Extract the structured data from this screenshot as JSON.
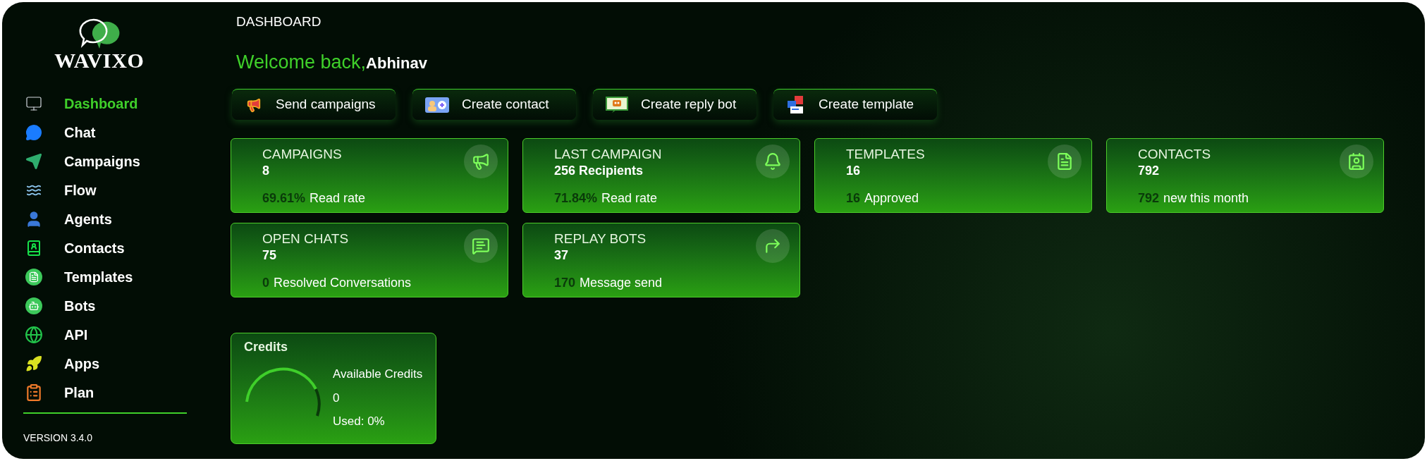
{
  "logo": {
    "text": "WAVIXO"
  },
  "sidebar": {
    "items": [
      {
        "label": "Dashboard",
        "selected": true
      },
      {
        "label": "Chat",
        "selected": false
      },
      {
        "label": "Campaigns",
        "selected": false
      },
      {
        "label": "Flow",
        "selected": false
      },
      {
        "label": "Agents",
        "selected": false
      },
      {
        "label": "Contacts",
        "selected": false
      },
      {
        "label": "Templates",
        "selected": false
      },
      {
        "label": "Bots",
        "selected": false
      },
      {
        "label": "API",
        "selected": false
      },
      {
        "label": "Apps",
        "selected": false
      },
      {
        "label": "Plan",
        "selected": false
      }
    ],
    "version": "VERSION 3.4.0"
  },
  "page_title": "DASHBOARD",
  "welcome": {
    "greeting": "Welcome back,",
    "name": "Abhinav"
  },
  "quick_actions": [
    "Send campaigns",
    "Create contact",
    "Create reply bot",
    "Create template"
  ],
  "stat_cards": [
    {
      "title": "CAMPAIGNS",
      "value": "8",
      "stat": "69.61%",
      "stat_label": "Read rate"
    },
    {
      "title": "LAST CAMPAIGN",
      "value": "256 Recipients",
      "stat": "71.84%",
      "stat_label": "Read rate"
    },
    {
      "title": "TEMPLATES",
      "value": "16",
      "stat": "16",
      "stat_label": "Approved"
    },
    {
      "title": "CONTACTS",
      "value": "792",
      "stat": "792",
      "stat_label": "new this month"
    },
    {
      "title": "OPEN CHATS",
      "value": "75",
      "stat": "0",
      "stat_label": "Resolved Conversations"
    },
    {
      "title": "REPLAY BOTS",
      "value": "37",
      "stat": "170",
      "stat_label": "Message send"
    }
  ],
  "credits": {
    "title": "Credits",
    "label": "Available Credits",
    "value": "0",
    "used": "Used: 0%"
  }
}
